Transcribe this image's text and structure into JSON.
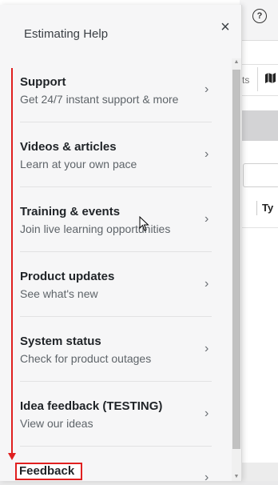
{
  "panel": {
    "title": "Estimating Help",
    "close_label": "×",
    "items": [
      {
        "title": "Support",
        "subtitle": "Get 24/7 instant support & more",
        "chevron": "›"
      },
      {
        "title": "Videos & articles",
        "subtitle": "Learn at your own pace",
        "chevron": "›"
      },
      {
        "title": "Training & events",
        "subtitle": "Join live learning opportunities",
        "chevron": "›"
      },
      {
        "title": "Product updates",
        "subtitle": "See what's new",
        "chevron": "›"
      },
      {
        "title": "System status",
        "subtitle": "Check for product outages",
        "chevron": "›"
      },
      {
        "title": "Idea feedback (TESTING)",
        "subtitle": "View our ideas",
        "chevron": "›"
      }
    ],
    "feedback": {
      "title": "Feedback",
      "chevron": "›"
    }
  },
  "background": {
    "help_icon_label": "?",
    "toolbar_text": "ts",
    "map_icon": "map-icon",
    "column_header": "Ty"
  },
  "colors": {
    "annotation_red": "#e02020",
    "panel_bg": "#f6f6f7",
    "title_text": "#1f2327",
    "subtitle_text": "#5e6469"
  }
}
